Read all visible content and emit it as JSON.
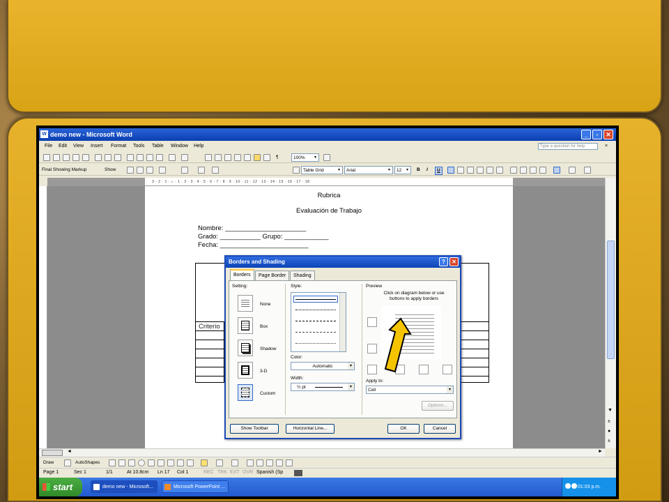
{
  "window": {
    "title": "demo new - Microsoft Word",
    "controls": {
      "minimize": "_",
      "maximize": "▫",
      "close": "✕"
    }
  },
  "menu": {
    "items": [
      "File",
      "Edit",
      "View",
      "Insert",
      "Format",
      "Tools",
      "Table",
      "Window",
      "Help"
    ],
    "ask_placeholder": "Type a question for help",
    "doc_close": "×"
  },
  "toolbar": {
    "zoom": "100%",
    "markup": "Final Showing Markup",
    "show": "Show",
    "style": "Table Grid",
    "font": "Arial",
    "size": "12",
    "bold": "B",
    "italic": "I",
    "underline": "U",
    "pilcrow": "¶"
  },
  "ruler": {
    "ticks": "3 · 2 · 1 · ⌂ · 1 · 2 · 3 · 4 · 5 · 6 · 7 · 8 · 9 · 10 · 11 · 12 · 13 · 14 · 15 · 16 · 17 · 18"
  },
  "document": {
    "title": "Rubrica",
    "subtitle": "Evaluación de Trabajo",
    "nombre": "Nombre: ______________________",
    "grado": "Grado: ___________ Grupo: ____________",
    "fecha": "Fecha: ________________________",
    "table_cell": "Criterio"
  },
  "dialog": {
    "title": "Borders and Shading",
    "help": "?",
    "close": "✕",
    "tabs": [
      "Borders",
      "Page Border",
      "Shading"
    ],
    "setting_label": "Setting:",
    "settings": [
      "None",
      "Box",
      "Shadow",
      "3-D",
      "Custom"
    ],
    "style_label": "Style:",
    "color_label": "Color:",
    "color_value": "Automatic",
    "width_label": "Width:",
    "width_value": "½ pt",
    "preview_label": "Preview",
    "preview_hint": "Click on diagram below or use buttons to apply borders",
    "apply_label": "Apply to:",
    "apply_value": "Cell",
    "options": "Options...",
    "show_toolbar": "Show Toolbar",
    "horizontal_line": "Horizontal Line...",
    "ok": "OK",
    "cancel": "Cancel"
  },
  "drawbar": {
    "draw": "Draw",
    "autoshapes": "AutoShapes"
  },
  "status": {
    "page": "Page 1",
    "sec": "Sec 1",
    "pages": "1/1",
    "at": "At 10.8cm",
    "ln": "Ln 17",
    "col": "Col 1",
    "rec": "REC",
    "trk": "TRK",
    "ext": "EXT",
    "ovr": "OVR",
    "lang": "Spanish (Sp"
  },
  "taskbar": {
    "start": "start",
    "items": [
      "demo new - Microsoft...",
      "Microsoft PowerPoint ..."
    ],
    "time": "01:03 p.m."
  },
  "colors": {
    "slide_gold": "#e3ad22",
    "xp_blue": "#0a3fb0",
    "arrow_yellow": "#f5c400"
  }
}
